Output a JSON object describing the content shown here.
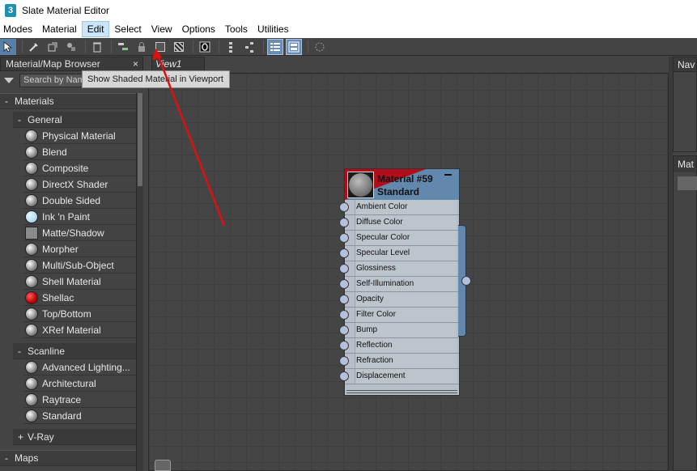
{
  "window": {
    "title": "Slate Material Editor",
    "app_icon": "3"
  },
  "menu": [
    "Modes",
    "Material",
    "Edit",
    "Select",
    "View",
    "Options",
    "Tools",
    "Utilities"
  ],
  "toolbar_icons": [
    "select-arrow-icon",
    "eyedropper-icon",
    "put-to-scene-icon",
    "assign-to-selection-icon",
    "delete-icon",
    "move-children-icon",
    "lock-icon",
    "show-shaded-material-icon",
    "show-realistic-icon",
    "show-background-icon",
    "layout-all-icon",
    "layout-children-icon",
    "material-map-browser-icon",
    "parameter-editor-icon",
    "select-by-material-icon"
  ],
  "browser": {
    "title": "Material/Map Browser",
    "close": "×",
    "search_placeholder": "Search by Nam",
    "materials_label": "Materials",
    "sections": [
      {
        "label": "General",
        "sign": "-",
        "items": [
          {
            "label": "Physical Material",
            "swatch": "sphere"
          },
          {
            "label": "Blend",
            "swatch": "sphere"
          },
          {
            "label": "Composite",
            "swatch": "sphere"
          },
          {
            "label": "DirectX Shader",
            "swatch": "sphere"
          },
          {
            "label": "Double Sided",
            "swatch": "sphere"
          },
          {
            "label": "Ink 'n Paint",
            "swatch": "ink"
          },
          {
            "label": "Matte/Shadow",
            "swatch": "square"
          },
          {
            "label": "Morpher",
            "swatch": "sphere"
          },
          {
            "label": "Multi/Sub-Object",
            "swatch": "sphere"
          },
          {
            "label": "Shell Material",
            "swatch": "sphere"
          },
          {
            "label": "Shellac",
            "swatch": "shellac"
          },
          {
            "label": "Top/Bottom",
            "swatch": "sphere"
          },
          {
            "label": "XRef Material",
            "swatch": "sphere"
          }
        ]
      },
      {
        "label": "Scanline",
        "sign": "-",
        "items": [
          {
            "label": "Advanced Lighting...",
            "swatch": "sphere"
          },
          {
            "label": "Architectural",
            "swatch": "sphere"
          },
          {
            "label": "Raytrace",
            "swatch": "sphere"
          },
          {
            "label": "Standard",
            "swatch": "sphere"
          }
        ]
      },
      {
        "label": "V-Ray",
        "sign": "+",
        "items": []
      }
    ],
    "maps_label": "Maps"
  },
  "view": {
    "tab": "View1"
  },
  "tooltip": "Show Shaded Material in Viewport",
  "node": {
    "name": "Material #59",
    "type": "Standard",
    "slots": [
      "Ambient Color",
      "Diffuse Color",
      "Specular Color",
      "Specular Level",
      "Glossiness",
      "Self-Illumination",
      "Opacity",
      "Filter Color",
      "Bump",
      "Reflection",
      "Refraction",
      "Displacement"
    ]
  },
  "right_panels": {
    "navigator": "Nav",
    "material": "Mat"
  },
  "annotation": {
    "color": "#e01010"
  }
}
